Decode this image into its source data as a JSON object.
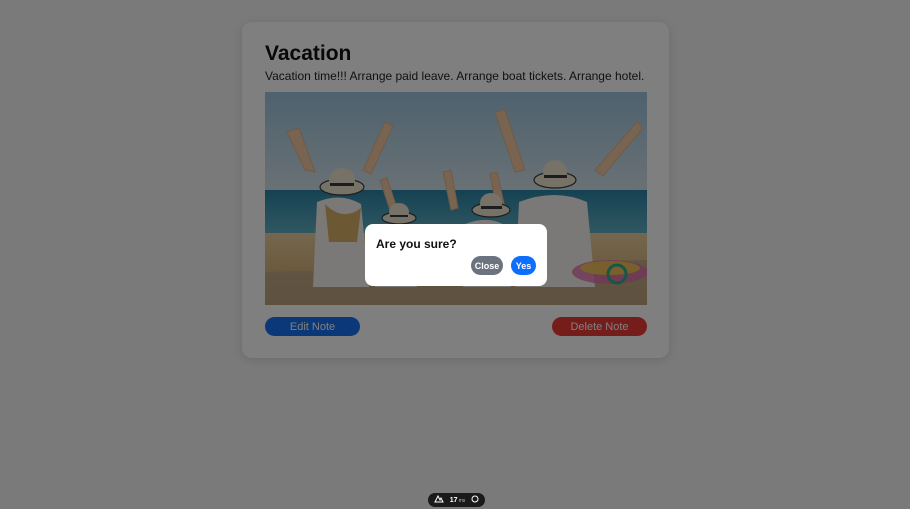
{
  "note": {
    "title": "Vacation",
    "body": "Vacation time!!! Arrange paid leave. Arrange boat tickets. Arrange hotel.",
    "image_alt": "Family on beach with raised arms"
  },
  "actions": {
    "edit_label": "Edit Note",
    "delete_label": "Delete Note"
  },
  "modal": {
    "title": "Are you sure?",
    "close_label": "Close",
    "yes_label": "Yes"
  },
  "devtools": {
    "render_time": "17",
    "unit": "ms"
  },
  "colors": {
    "edit_button": "#1470f3",
    "delete_button": "#ea3a35",
    "modal_close": "#6b7280",
    "modal_yes": "#0d6efd"
  }
}
